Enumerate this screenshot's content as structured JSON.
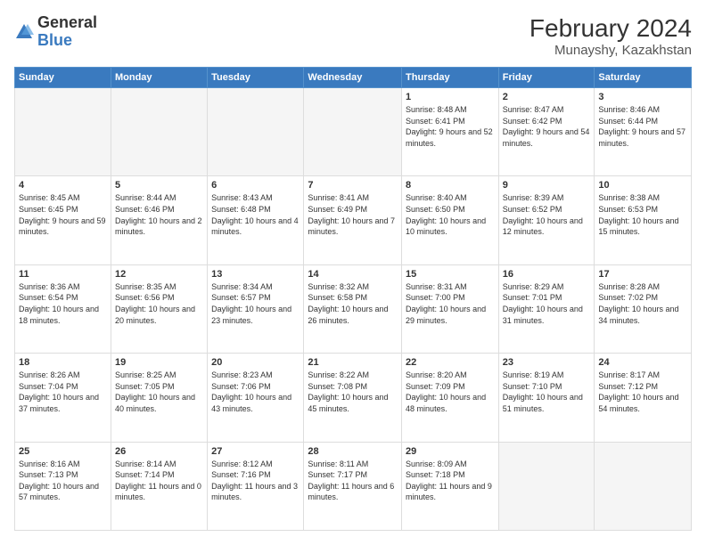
{
  "header": {
    "logo_general": "General",
    "logo_blue": "Blue",
    "month_year": "February 2024",
    "location": "Munayshy, Kazakhstan"
  },
  "days_of_week": [
    "Sunday",
    "Monday",
    "Tuesday",
    "Wednesday",
    "Thursday",
    "Friday",
    "Saturday"
  ],
  "weeks": [
    [
      {
        "num": "",
        "info": ""
      },
      {
        "num": "",
        "info": ""
      },
      {
        "num": "",
        "info": ""
      },
      {
        "num": "",
        "info": ""
      },
      {
        "num": "1",
        "info": "Sunrise: 8:48 AM\nSunset: 6:41 PM\nDaylight: 9 hours\nand 52 minutes."
      },
      {
        "num": "2",
        "info": "Sunrise: 8:47 AM\nSunset: 6:42 PM\nDaylight: 9 hours\nand 54 minutes."
      },
      {
        "num": "3",
        "info": "Sunrise: 8:46 AM\nSunset: 6:44 PM\nDaylight: 9 hours\nand 57 minutes."
      }
    ],
    [
      {
        "num": "4",
        "info": "Sunrise: 8:45 AM\nSunset: 6:45 PM\nDaylight: 9 hours\nand 59 minutes."
      },
      {
        "num": "5",
        "info": "Sunrise: 8:44 AM\nSunset: 6:46 PM\nDaylight: 10 hours\nand 2 minutes."
      },
      {
        "num": "6",
        "info": "Sunrise: 8:43 AM\nSunset: 6:48 PM\nDaylight: 10 hours\nand 4 minutes."
      },
      {
        "num": "7",
        "info": "Sunrise: 8:41 AM\nSunset: 6:49 PM\nDaylight: 10 hours\nand 7 minutes."
      },
      {
        "num": "8",
        "info": "Sunrise: 8:40 AM\nSunset: 6:50 PM\nDaylight: 10 hours\nand 10 minutes."
      },
      {
        "num": "9",
        "info": "Sunrise: 8:39 AM\nSunset: 6:52 PM\nDaylight: 10 hours\nand 12 minutes."
      },
      {
        "num": "10",
        "info": "Sunrise: 8:38 AM\nSunset: 6:53 PM\nDaylight: 10 hours\nand 15 minutes."
      }
    ],
    [
      {
        "num": "11",
        "info": "Sunrise: 8:36 AM\nSunset: 6:54 PM\nDaylight: 10 hours\nand 18 minutes."
      },
      {
        "num": "12",
        "info": "Sunrise: 8:35 AM\nSunset: 6:56 PM\nDaylight: 10 hours\nand 20 minutes."
      },
      {
        "num": "13",
        "info": "Sunrise: 8:34 AM\nSunset: 6:57 PM\nDaylight: 10 hours\nand 23 minutes."
      },
      {
        "num": "14",
        "info": "Sunrise: 8:32 AM\nSunset: 6:58 PM\nDaylight: 10 hours\nand 26 minutes."
      },
      {
        "num": "15",
        "info": "Sunrise: 8:31 AM\nSunset: 7:00 PM\nDaylight: 10 hours\nand 29 minutes."
      },
      {
        "num": "16",
        "info": "Sunrise: 8:29 AM\nSunset: 7:01 PM\nDaylight: 10 hours\nand 31 minutes."
      },
      {
        "num": "17",
        "info": "Sunrise: 8:28 AM\nSunset: 7:02 PM\nDaylight: 10 hours\nand 34 minutes."
      }
    ],
    [
      {
        "num": "18",
        "info": "Sunrise: 8:26 AM\nSunset: 7:04 PM\nDaylight: 10 hours\nand 37 minutes."
      },
      {
        "num": "19",
        "info": "Sunrise: 8:25 AM\nSunset: 7:05 PM\nDaylight: 10 hours\nand 40 minutes."
      },
      {
        "num": "20",
        "info": "Sunrise: 8:23 AM\nSunset: 7:06 PM\nDaylight: 10 hours\nand 43 minutes."
      },
      {
        "num": "21",
        "info": "Sunrise: 8:22 AM\nSunset: 7:08 PM\nDaylight: 10 hours\nand 45 minutes."
      },
      {
        "num": "22",
        "info": "Sunrise: 8:20 AM\nSunset: 7:09 PM\nDaylight: 10 hours\nand 48 minutes."
      },
      {
        "num": "23",
        "info": "Sunrise: 8:19 AM\nSunset: 7:10 PM\nDaylight: 10 hours\nand 51 minutes."
      },
      {
        "num": "24",
        "info": "Sunrise: 8:17 AM\nSunset: 7:12 PM\nDaylight: 10 hours\nand 54 minutes."
      }
    ],
    [
      {
        "num": "25",
        "info": "Sunrise: 8:16 AM\nSunset: 7:13 PM\nDaylight: 10 hours\nand 57 minutes."
      },
      {
        "num": "26",
        "info": "Sunrise: 8:14 AM\nSunset: 7:14 PM\nDaylight: 11 hours\nand 0 minutes."
      },
      {
        "num": "27",
        "info": "Sunrise: 8:12 AM\nSunset: 7:16 PM\nDaylight: 11 hours\nand 3 minutes."
      },
      {
        "num": "28",
        "info": "Sunrise: 8:11 AM\nSunset: 7:17 PM\nDaylight: 11 hours\nand 6 minutes."
      },
      {
        "num": "29",
        "info": "Sunrise: 8:09 AM\nSunset: 7:18 PM\nDaylight: 11 hours\nand 9 minutes."
      },
      {
        "num": "",
        "info": ""
      },
      {
        "num": "",
        "info": ""
      }
    ]
  ]
}
